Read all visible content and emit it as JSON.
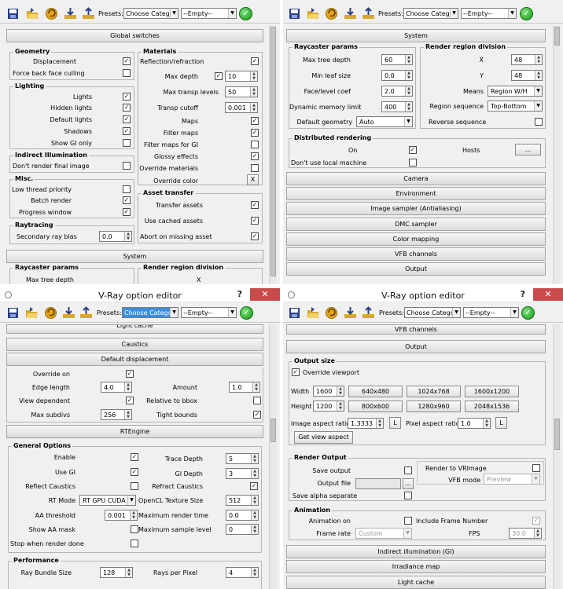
{
  "colors": {
    "accent": "#3b8ee0",
    "close": "#c74b4b",
    "ok": "#139a13"
  },
  "common": {
    "presets_label": "Presets:",
    "presets_value": "Choose Categor",
    "empty_value": "--Empty--",
    "toolbar_icons": [
      "save-icon",
      "open-icon",
      "reset-icon",
      "load-icon",
      "export-icon"
    ],
    "title": "V-Ray option editor",
    "help": "?",
    "close": "✕",
    "check": "✓",
    "check_cb": "✓"
  },
  "tl": {
    "global_switches": "Global switches",
    "system": "System",
    "geometry": {
      "title": "Geometry",
      "displacement": "Displacement",
      "force_back": "Force back face culling"
    },
    "lighting": {
      "title": "Lighting",
      "lights": "Lights",
      "hidden": "Hidden lights",
      "default": "Default lights",
      "shadows": "Shadows",
      "show_gi": "Show GI only"
    },
    "indirect": {
      "title": "Indirect Illumination",
      "dont_render": "Don't render final image"
    },
    "misc": {
      "title": "Misc.",
      "low_thread": "Low thread priority",
      "batch": "Batch render",
      "progress": "Progress window"
    },
    "raytracing": {
      "title": "Raytracing",
      "secondary": "Secondary ray bias",
      "secondary_val": "0.0"
    },
    "materials": {
      "title": "Materials",
      "refl": "Reflection/refraction",
      "max_depth": "Max depth",
      "max_depth_val": "10",
      "max_transp": "Max transp levels",
      "max_transp_val": "50",
      "transp_cutoff": "Transp cutoff",
      "transp_cutoff_val": "0.001",
      "maps": "Maps",
      "filter_maps": "Filter maps",
      "filter_gi": "Filter maps for GI",
      "glossy": "Glossy effects",
      "override_mat": "Override materials",
      "override_color": "Override color",
      "override_color_val": "X"
    },
    "asset": {
      "title": "Asset transfer",
      "transfer": "Transfer assets",
      "cached": "Use cached assets",
      "abort": "Abort on missing asset"
    },
    "raycaster_peek": "Raycaster params",
    "render_region_peek": "Render region division",
    "max_tree_peek": "Max tree depth",
    "x_peek": "X"
  },
  "tr": {
    "system": "System",
    "raycaster": {
      "title": "Raycaster params",
      "max_tree": "Max tree depth",
      "max_tree_val": "60",
      "min_leaf": "Min leaf size",
      "min_leaf_val": "0.0",
      "face_level": "Face/level coef",
      "face_level_val": "2.0",
      "dyn_mem": "Dynamic memory limit",
      "dyn_mem_val": "400",
      "default_geom": "Default geometry",
      "default_geom_val": "Auto"
    },
    "region": {
      "title": "Render region division",
      "x": "X",
      "x_val": "48",
      "y": "Y",
      "y_val": "48",
      "means": "Means",
      "means_val": "Region W/H",
      "seq": "Region sequence",
      "seq_val": "Top-Bottom",
      "reverse": "Reverse sequence"
    },
    "distributed": {
      "title": "Distributed rendering",
      "on": "On",
      "hosts": "Hosts",
      "hosts_btn": "...",
      "dont_local": "Don't use local machine"
    },
    "rollouts": [
      "Camera",
      "Environment",
      "Image sampler (Antialiasing)",
      "DMC sampler",
      "Color mapping",
      "VFB channels",
      "Output"
    ]
  },
  "bl": {
    "top_peek": "Light cache",
    "caustics": "Caustics",
    "default_disp": "Default displacement",
    "disp": {
      "override_on": "Override on",
      "edge_length": "Edge length",
      "edge_length_val": "4.0",
      "view_dependent": "View dependent",
      "max_subdivs": "Max subdivs",
      "max_subdivs_val": "256",
      "amount": "Amount",
      "amount_val": "1.0",
      "relative": "Relative to bbox",
      "tight": "Tight bounds"
    },
    "rtengine": "RTEngine",
    "general": {
      "title": "General Options",
      "enable": "Enable",
      "use_gi": "Use GI",
      "reflect": "Reflect Caustics",
      "rt_mode": "RT Mode",
      "rt_mode_val": "RT GPU CUDA",
      "aa": "AA threshold",
      "aa_val": "0.001",
      "show_aa": "Show AA mask",
      "stop": "Stop when render done",
      "trace_depth": "Trace Depth",
      "trace_depth_val": "5",
      "gi_depth": "GI Depth",
      "gi_depth_val": "3",
      "refract": "Refract Caustics",
      "opencl": "OpenCL Texture Size",
      "opencl_val": "512",
      "max_time": "Maximum render time",
      "max_time_val": "0.0",
      "max_sample": "Maximum sample level",
      "max_sample_val": "0"
    },
    "performance": {
      "title": "Performance",
      "ray_bundle": "Ray Bundle Size",
      "ray_bundle_val": "128",
      "rays_per_pixel": "Rays per Pixel",
      "rays_per_pixel_val": "4"
    }
  },
  "br": {
    "vfb_peek": "VFB channels",
    "output": "Output",
    "output_size": {
      "title": "Output size",
      "override": "Override viewport",
      "width": "Width",
      "width_val": "1600",
      "height": "Height",
      "height_val": "1200",
      "presets": [
        "640x480",
        "1024x768",
        "1600x1200",
        "800x600",
        "1280x960",
        "2048x1536"
      ],
      "img_aspect": "Image aspect ratio",
      "img_aspect_val": "1.3333",
      "lock": "L",
      "pix_aspect": "Pixel aspect ratio",
      "pix_aspect_val": "1.0",
      "get_view": "Get view aspect"
    },
    "render_output": {
      "title": "Render Output",
      "save": "Save output",
      "file": "Output file",
      "browse": "...",
      "alpha": "Save alpha separate",
      "vrimage": "Render to VRImage",
      "vfb_mode": "VFB mode",
      "vfb_mode_val": "Preview"
    },
    "animation": {
      "title": "Animation",
      "anim_on": "Animation on",
      "frame_rate": "Frame rate",
      "frame_rate_val": "Custom",
      "include": "Include Frame Number",
      "fps": "FPS",
      "fps_val": "30.0"
    },
    "indirect": "Indirect illumination (GI)",
    "irradiance": "Irradiance map",
    "lightcache_peek": "Light cache"
  }
}
